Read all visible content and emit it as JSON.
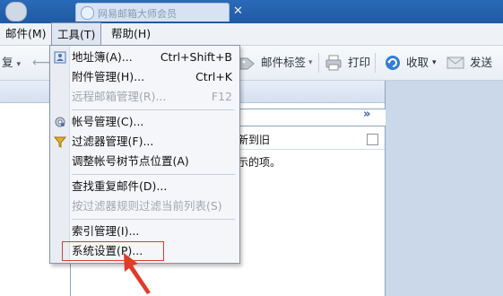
{
  "titlebar": {
    "tab_title": "网易邮箱大师会员"
  },
  "menubar": {
    "items": [
      {
        "label": "邮件(M)"
      },
      {
        "label": "工具(T)"
      },
      {
        "label": "帮助(H)"
      }
    ]
  },
  "toolbar": {
    "reply_partial": "复",
    "tag_label": "邮件标签",
    "print_label": "打印",
    "receive_label": "收取",
    "send_label": "发送"
  },
  "list": {
    "sort_label": "新到旧",
    "empty_text": "示的项。"
  },
  "tools_menu": {
    "items": [
      {
        "label": "地址簿(A)...",
        "shortcut": "Ctrl+Shift+B",
        "disabled": false,
        "icon": "address-book-icon"
      },
      {
        "label": "附件管理(H)...",
        "shortcut": "Ctrl+K",
        "disabled": false
      },
      {
        "label": "远程邮箱管理(R)...",
        "shortcut": "F12",
        "disabled": true
      },
      {
        "label": "帐号管理(C)...",
        "shortcut": "",
        "disabled": false,
        "icon": "account-gear-icon"
      },
      {
        "label": "过滤器管理(F)...",
        "shortcut": "",
        "disabled": false,
        "icon": "filter-funnel-icon"
      },
      {
        "label": "调整帐号树节点位置(A)",
        "shortcut": "",
        "disabled": false
      },
      {
        "label": "查找重复邮件(D)...",
        "shortcut": "",
        "disabled": false
      },
      {
        "label": "按过滤器规则过滤当前列表(S)",
        "shortcut": "",
        "disabled": true
      },
      {
        "label": "索引管理(I)...",
        "shortcut": "",
        "disabled": false
      },
      {
        "label": "系统设置(P)...",
        "shortcut": "",
        "disabled": false
      }
    ]
  },
  "colors": {
    "highlight": "#e23a2b",
    "arrow": "#e23a2b"
  }
}
